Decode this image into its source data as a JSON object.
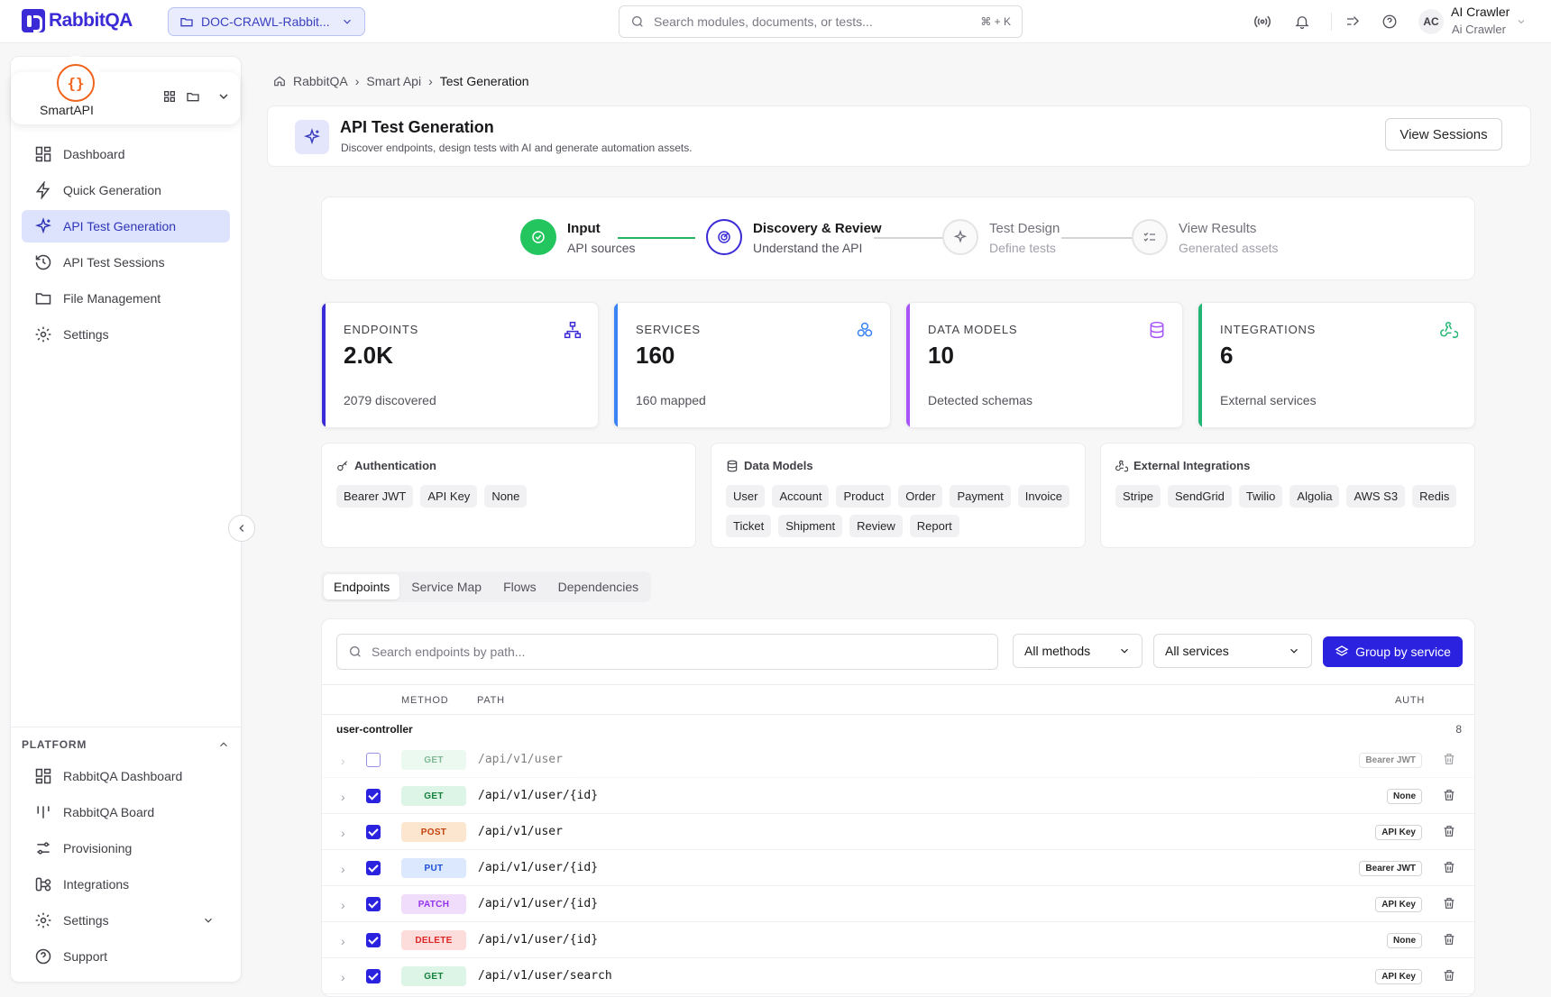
{
  "topbar": {
    "logo_text": "RabbitQA",
    "project_name": "DOC-CRAWL-Rabbit...",
    "search_placeholder": "Search modules, documents, or tests...",
    "search_shortcut": "⌘ + K",
    "avatar_initials": "AC",
    "user_name": "AI Crawler",
    "user_sub": "Ai Crawler"
  },
  "sidebar": {
    "app_name": "SmartAPI",
    "app_logo_glyph": "{}",
    "items": [
      {
        "label": "Dashboard",
        "icon": "dashboard-icon"
      },
      {
        "label": "Quick Generation",
        "icon": "lightning-icon"
      },
      {
        "label": "API Test Generation",
        "icon": "sparkle-icon",
        "active": true
      },
      {
        "label": "API Test Sessions",
        "icon": "history-icon"
      },
      {
        "label": "File Management",
        "icon": "folder-icon"
      },
      {
        "label": "Settings",
        "icon": "gear-icon"
      }
    ],
    "platform_title": "PLATFORM",
    "platform_items": [
      {
        "label": "RabbitQA Dashboard",
        "icon": "dashboard-icon"
      },
      {
        "label": "RabbitQA Board",
        "icon": "board-icon"
      },
      {
        "label": "Provisioning",
        "icon": "sliders-icon"
      },
      {
        "label": "Integrations",
        "icon": "integrations-icon"
      },
      {
        "label": "Settings",
        "icon": "gear-icon"
      },
      {
        "label": "Support",
        "icon": "help-icon"
      }
    ]
  },
  "breadcrumb": [
    "RabbitQA",
    "Smart Api",
    "Test Generation"
  ],
  "header": {
    "title": "API Test Generation",
    "subtitle": "Discover endpoints, design tests with AI and generate automation assets.",
    "view_sessions": "View Sessions"
  },
  "stepper": [
    {
      "title": "Input",
      "sub": "API sources",
      "state": "done"
    },
    {
      "title": "Discovery & Review",
      "sub": "Understand the API",
      "state": "current"
    },
    {
      "title": "Test Design",
      "sub": "Define tests",
      "state": "todo"
    },
    {
      "title": "View Results",
      "sub": "Generated assets",
      "state": "todo"
    }
  ],
  "stats": [
    {
      "label": "ENDPOINTS",
      "value": "2.0K",
      "sub": "2079 discovered",
      "color": "#3b2bd6"
    },
    {
      "label": "SERVICES",
      "value": "160",
      "sub": "160 mapped",
      "color": "#3b82f6"
    },
    {
      "label": "DATA MODELS",
      "value": "10",
      "sub": "Detected schemas",
      "color": "#a855f7"
    },
    {
      "label": "INTEGRATIONS",
      "value": "6",
      "sub": "External services",
      "color": "#22b573"
    }
  ],
  "auth_card": {
    "title": "Authentication",
    "chips": [
      "Bearer JWT",
      "API Key",
      "None"
    ]
  },
  "models_card": {
    "title": "Data Models",
    "chips": [
      "User",
      "Account",
      "Product",
      "Order",
      "Payment",
      "Invoice",
      "Ticket",
      "Shipment",
      "Review",
      "Report"
    ]
  },
  "integrations_card": {
    "title": "External Integrations",
    "chips": [
      "Stripe",
      "SendGrid",
      "Twilio",
      "Algolia",
      "AWS S3",
      "Redis"
    ]
  },
  "tabs": [
    "Endpoints",
    "Service Map",
    "Flows",
    "Dependencies"
  ],
  "filters": {
    "search_placeholder": "Search endpoints by path...",
    "methods": "All methods",
    "services": "All services",
    "group_button": "Group by service"
  },
  "table": {
    "headers": {
      "method": "METHOD",
      "path": "PATH",
      "auth": "AUTH"
    },
    "group": {
      "name": "user-controller",
      "count": "8"
    },
    "rows": [
      {
        "method": "GET",
        "path": "/api/v1/user",
        "auth": "Bearer JWT",
        "checked": false,
        "dim": true
      },
      {
        "method": "GET",
        "path": "/api/v1/user/{id}",
        "auth": "None",
        "checked": true
      },
      {
        "method": "POST",
        "path": "/api/v1/user",
        "auth": "API Key",
        "checked": true
      },
      {
        "method": "PUT",
        "path": "/api/v1/user/{id}",
        "auth": "Bearer JWT",
        "checked": true
      },
      {
        "method": "PATCH",
        "path": "/api/v1/user/{id}",
        "auth": "API Key",
        "checked": true
      },
      {
        "method": "DELETE",
        "path": "/api/v1/user/{id}",
        "auth": "None",
        "checked": true
      },
      {
        "method": "GET",
        "path": "/api/v1/user/search",
        "auth": "API Key",
        "checked": true
      }
    ]
  }
}
